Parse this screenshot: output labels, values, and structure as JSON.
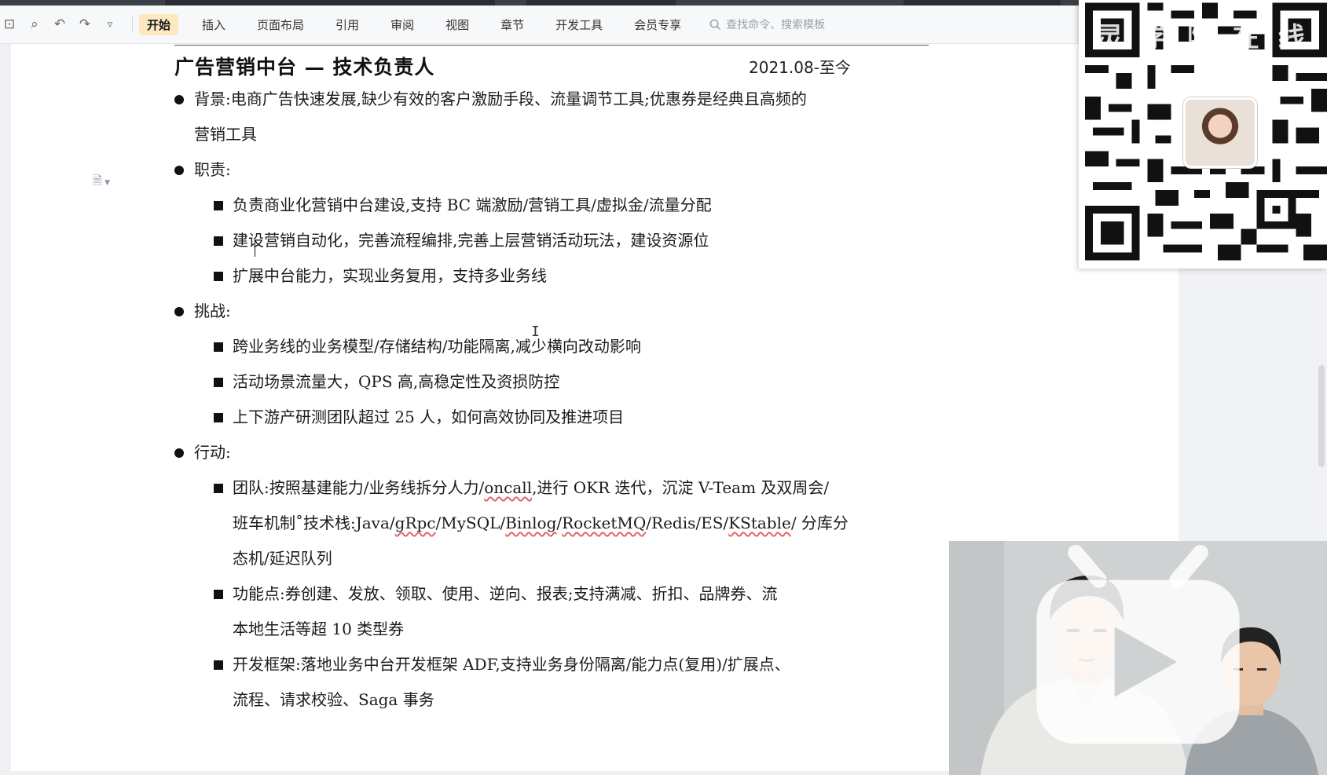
{
  "ribbon": {
    "tabs": [
      {
        "label": "开始",
        "active": true
      },
      {
        "label": "插入",
        "active": false
      },
      {
        "label": "页面布局",
        "active": false
      },
      {
        "label": "引用",
        "active": false
      },
      {
        "label": "审阅",
        "active": false
      },
      {
        "label": "视图",
        "active": false
      },
      {
        "label": "章节",
        "active": false
      },
      {
        "label": "开发工具",
        "active": false
      },
      {
        "label": "会员专享",
        "active": false
      }
    ],
    "search_placeholder": "查找命令、搜索模板",
    "accent_color": "#fde8c0"
  },
  "document": {
    "title": "广告营销中台 — 技术负责人",
    "date": "2021.08-至今",
    "background_line1": "背景:电商广告快速发展,缺少有效的客户激励手段、流量调节工具;优惠券是经典且高频的",
    "background_line2": "营销工具",
    "duty_heading": "职责:",
    "duties": [
      "负责商业化营销中台建设,支持 BC 端激励/营销工具/虚拟金/流量分配",
      "建设营销自动化，完善流程编排,完善上层营销活动玩法，建设资源位",
      "扩展中台能力，实现业务复用，支持多业务线"
    ],
    "challenge_heading": "挑战:",
    "challenges": [
      "跨业务线的业务模型/存储结构/功能隔离,减少横向改动影响",
      "活动场景流量大，QPS 高,高稳定性及资损防控",
      "上下游产研测团队超过 25 人，如何高效协同及推进项目"
    ],
    "action_heading": "行动:",
    "action_team_a": "团队:按照基建能力/业务线拆分人力/",
    "action_team_b": "oncall",
    "action_team_c": ",进行 OKR 迭代，沉淀 V-Team 及双周会/",
    "action_team_line2a": "班车机制˚技术栈:Java/",
    "action_team_line2b": "gRpc",
    "action_team_line2c": "/MySQL/",
    "action_team_line2d": "Binlog",
    "action_team_line2e": "/",
    "action_team_line2f": "RocketMQ",
    "action_team_line2g": "/Redis/ES/",
    "action_team_line2h": "KStable",
    "action_team_line2i": "/ 分库分",
    "action_team_line3": "态机/延迟队列",
    "action_func_line1": "功能点:券创建、发放、领取、使用、逆向、报表;支持满减、折扣、品牌券、流",
    "action_func_line2": "本地生活等超 10 类型券",
    "action_fw_line1": "开发框架:落地业务中台开发框架 ADF,支持业务身份隔离/能力点(复用)/扩展点、",
    "action_fw_line2": "流程、请求校验、Saga 事务"
  },
  "overlay": {
    "qr_watermark": "灵 学 院 在 线"
  },
  "icons": {
    "quick_access": [
      "save-icon",
      "print-preview-icon",
      "undo-icon",
      "redo-icon",
      "more-icon"
    ],
    "search": "search-icon",
    "doc_side": "document-icon",
    "video_badge": "play-badge-icon"
  }
}
